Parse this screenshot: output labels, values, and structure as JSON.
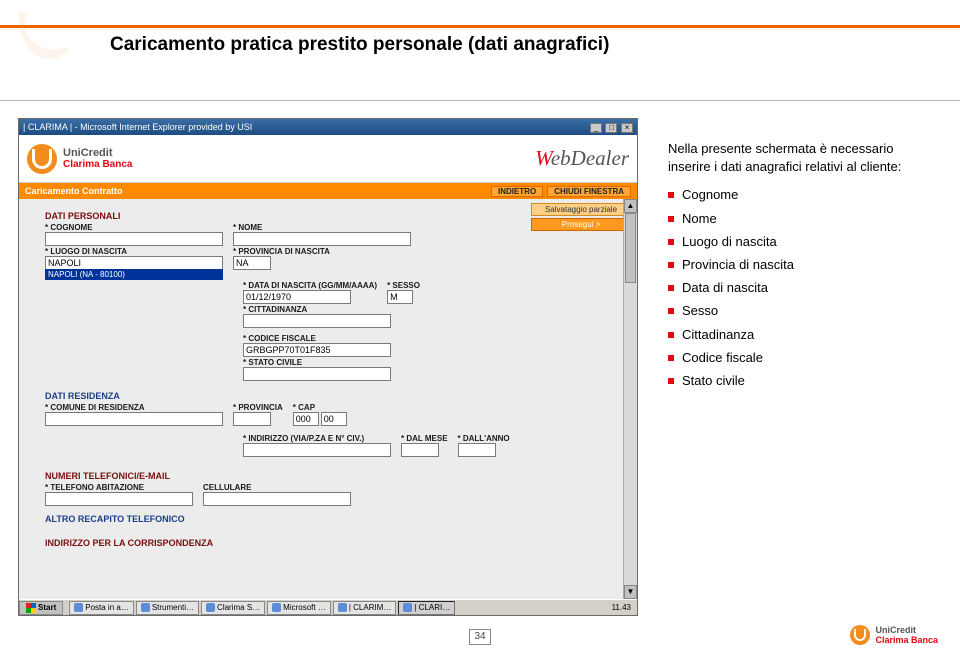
{
  "page": {
    "title": "Caricamento pratica prestito personale (dati anagrafici)",
    "number": "34"
  },
  "browser": {
    "title": "| CLARIMA | - Microsoft Internet Explorer provided by USI"
  },
  "bank": {
    "brand_top": "UniCredit",
    "brand_bottom": "Clarima Banca",
    "app_name_accent": "W",
    "app_name_rest": "ebDealer"
  },
  "orange_bar": {
    "left": "Caricamento Contratto",
    "btn_back": "INDIETRO",
    "btn_close": "CHIUDI FINESTRA"
  },
  "side_actions": {
    "save_partial": "Salvataggio parziale",
    "proceed": "Prosegui >"
  },
  "sections": {
    "personali": "DATI PERSONALI",
    "residenza": "DATI RESIDENZA",
    "telefono": "NUMERI TELEFONICI/E-MAIL",
    "altro_tel": "ALTRO RECAPITO TELEFONICO",
    "corrispondenza": "INDIRIZZO PER LA CORRISPONDENZA"
  },
  "fields": {
    "cognome": {
      "label": "* COGNOME",
      "value": ""
    },
    "nome": {
      "label": "* NOME",
      "value": ""
    },
    "luogo_nascita": {
      "label": "* LUOGO DI NASCITA",
      "value": "NAPOLI"
    },
    "provincia_nascita": {
      "label": "* PROVINCIA DI NASCITA",
      "value": "NA"
    },
    "dropdown_selected": "NAPOLI (NA - 80100)",
    "data_nascita": {
      "label": "* DATA DI NASCITA (GG/MM/AAAA)",
      "value": "01/12/1970"
    },
    "sesso": {
      "label": "* SESSO",
      "value": "M"
    },
    "cittadinanza": {
      "label": "* CITTADINANZA",
      "value": ""
    },
    "codice_fiscale": {
      "label": "* CODICE FISCALE",
      "value": "GRBGPP70T01F835"
    },
    "stato_civile": {
      "label": "* STATO CIVILE",
      "value": ""
    },
    "comune_residenza": {
      "label": "* COMUNE DI RESIDENZA",
      "value": ""
    },
    "provincia": {
      "label": "* PROVINCIA",
      "value": ""
    },
    "cap": {
      "label": "* CAP",
      "value1": "000",
      "value2": "00"
    },
    "indirizzo": {
      "label": "* INDIRIZZO (VIA/P.ZA E N° CIV.)",
      "value": ""
    },
    "dal_mese": {
      "label": "* DAL MESE",
      "value": ""
    },
    "dall_anno": {
      "label": "* DALL'ANNO",
      "value": ""
    },
    "tel_abitazione": {
      "label": "* TELEFONO ABITAZIONE",
      "value": ""
    },
    "cellulare": {
      "label": "CELLULARE",
      "value": ""
    }
  },
  "notes": {
    "intro": "Nella presente schermata è necessario inserire i dati anagrafici relativi al cliente:",
    "items": [
      "Cognome",
      "Nome",
      "Luogo di nascita",
      "Provincia di nascita",
      "Data di nascita",
      "Sesso",
      "Cittadinanza",
      "Codice fiscale",
      "Stato civile"
    ]
  },
  "taskbar": {
    "start": "Start",
    "items": [
      "Posta in a…",
      "Strumenti…",
      "Clarima S…",
      "Microsoft …",
      "| CLARIM…",
      "| CLARI…"
    ],
    "clock": "11.43"
  },
  "footer_logo": {
    "t1": "UniCredit",
    "t2": "Clarima Banca"
  }
}
